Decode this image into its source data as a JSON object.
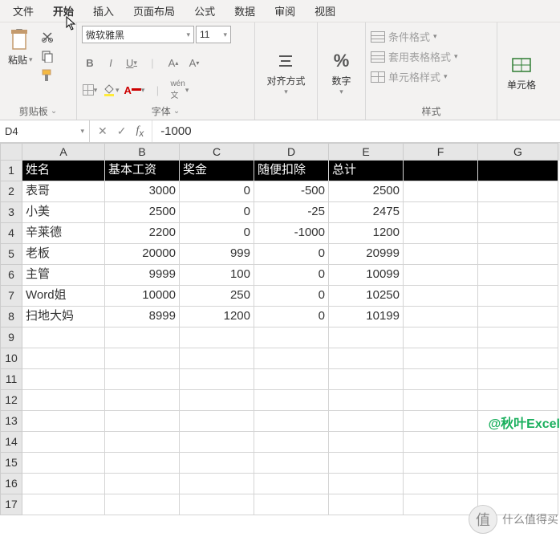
{
  "menu": [
    "文件",
    "开始",
    "插入",
    "页面布局",
    "公式",
    "数据",
    "审阅",
    "视图"
  ],
  "activeMenu": 1,
  "ribbon": {
    "clipboard": {
      "paste": "粘贴",
      "label": "剪贴板"
    },
    "font": {
      "name": "微软雅黑",
      "size": "11",
      "label": "字体"
    },
    "align": {
      "btn": "对齐方式"
    },
    "number": {
      "btn": "数字"
    },
    "styles": {
      "cond": "条件格式",
      "table": "套用表格格式",
      "cell": "单元格样式",
      "label": "样式"
    },
    "cells": {
      "btn": "单元格"
    }
  },
  "nameBox": "D4",
  "formula": "-1000",
  "cols": [
    "A",
    "B",
    "C",
    "D",
    "E",
    "F",
    "G"
  ],
  "headers": [
    "姓名",
    "基本工资",
    "奖金",
    "随便扣除",
    "总计"
  ],
  "rows": [
    {
      "n": "2",
      "a": "表哥",
      "b": "3000",
      "c": "0",
      "d": "-500",
      "e": "2500"
    },
    {
      "n": "3",
      "a": "小美",
      "b": "2500",
      "c": "0",
      "d": "-25",
      "e": "2475"
    },
    {
      "n": "4",
      "a": "辛莱德",
      "b": "2200",
      "c": "0",
      "d": "-1000",
      "e": "1200"
    },
    {
      "n": "5",
      "a": "老板",
      "b": "20000",
      "c": "999",
      "d": "0",
      "e": "20999"
    },
    {
      "n": "6",
      "a": "主管",
      "b": "9999",
      "c": "100",
      "d": "0",
      "e": "10099"
    },
    {
      "n": "7",
      "a": "Word姐",
      "b": "10000",
      "c": "250",
      "d": "0",
      "e": "10250"
    },
    {
      "n": "8",
      "a": "扫地大妈",
      "b": "8999",
      "c": "1200",
      "d": "0",
      "e": "10199"
    }
  ],
  "emptyRows": [
    "9",
    "10",
    "11",
    "12",
    "13",
    "14",
    "15",
    "16",
    "17"
  ],
  "watermark": "@秋叶Excel",
  "badge": "什么值得买"
}
